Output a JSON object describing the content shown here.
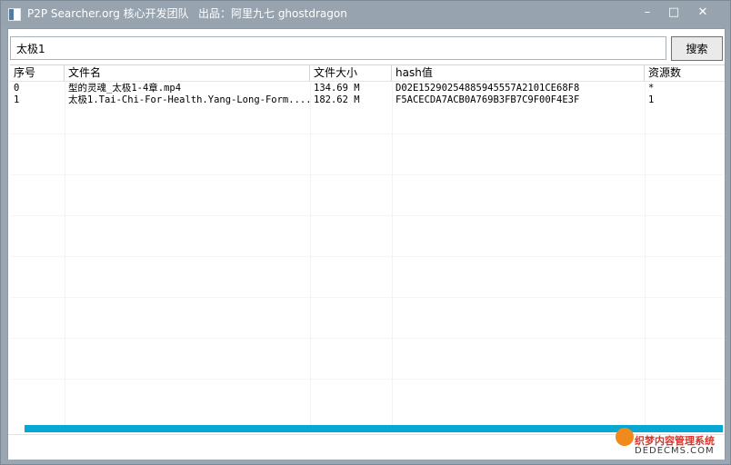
{
  "window": {
    "title": "P2P Searcher.org 核心开发团队",
    "credit": "出品：阿里九七 ghostdragon",
    "minimize_icon": "minimize-icon",
    "maximize_icon": "maximize-icon",
    "close_icon": "close-icon"
  },
  "search": {
    "value": "太极1",
    "button_label": "搜索"
  },
  "table": {
    "headers": [
      "序号",
      "文件名",
      "文件大小",
      "hash值",
      "资源数"
    ],
    "rows": [
      [
        "0",
        "型的灵魂_太极1-4章.mp4",
        "134.69 M",
        "D02E15290254885945557A2101CE68F8",
        "*"
      ],
      [
        "1",
        "太极1.Tai-Chi-For-Health.Yang-Long-Form....",
        "182.62 M",
        "F5ACECDA7ACB0A769B3FB7C9F00F4E3F",
        "1"
      ]
    ]
  },
  "progress": {
    "fraction": 1.0,
    "color": "#06a7d3"
  },
  "watermark": {
    "title": "织梦内容管理系统",
    "url": "DEDECMS.COM"
  }
}
